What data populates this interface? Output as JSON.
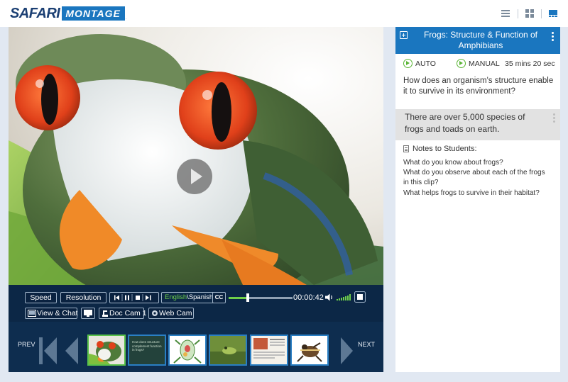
{
  "header": {
    "logo_part1": "SAFARI",
    "logo_part2": "MONTAGE",
    "logo_tm": ".",
    "view_icons": [
      "list-view-icon",
      "grid-view-icon",
      "player-view-icon"
    ]
  },
  "player": {
    "play_icon": "play-icon",
    "controls": {
      "speed": "Speed",
      "resolution": "Resolution",
      "lang_english": "English",
      "lang_sep": "\\",
      "lang_spanish": "Spanish",
      "cc": "CC",
      "timecode": "00:00:42",
      "progress": 0.3,
      "view_chat": "View & Chat",
      "doc_cam": "Doc Cam 1",
      "web_cam": "Web Cam"
    },
    "strip": {
      "prev": "PREV",
      "next": "NEXT",
      "active_index": 0,
      "thumbnails": [
        {
          "name": "frog-thumbnail"
        },
        {
          "name": "question-slide-thumbnail",
          "text": "How does structure complement function in frogs?"
        },
        {
          "name": "frog-anatomy-thumbnail"
        },
        {
          "name": "frog-in-water-thumbnail"
        },
        {
          "name": "article-page-thumbnail"
        },
        {
          "name": "frog-sketch-thumbnail"
        }
      ]
    }
  },
  "side": {
    "title": "Frogs: Structure & Function of Amphibians",
    "auto": "AUTO",
    "manual": "MANUAL",
    "duration": "35 mins 20 sec",
    "question": "How does an organism's structure enable it to survive in its environment?",
    "fact": "There are over 5,000 species of frogs and toads on earth.",
    "notes_title": "Notes to Students:",
    "notes": [
      "What do you know about frogs?",
      "What do you observe about each of the frogs",
      "in this clip?",
      "What helps frogs to survive in their habitat?"
    ]
  },
  "colors": {
    "brand_navy": "#1b3f73",
    "brand_blue": "#1a76bf",
    "accent_green": "#5ab535",
    "player_bg": "#0e2d4f"
  }
}
